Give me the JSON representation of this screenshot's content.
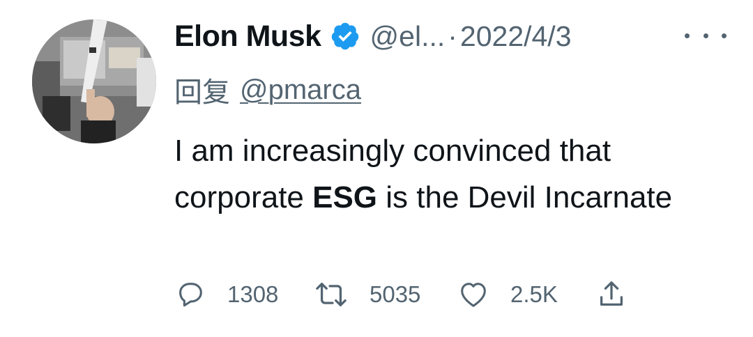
{
  "author": {
    "name": "Elon Musk",
    "handle": "@el...",
    "separator": "·",
    "date": "2022/4/3",
    "verified_icon": "verified-badge-icon"
  },
  "reply": {
    "prefix": "回复",
    "mention": "@pmarca"
  },
  "tweet": {
    "text_before": "I am increasingly convinced that corporate ",
    "text_bold": "ESG",
    "text_after": " is the Devil Incarnate"
  },
  "actions": {
    "reply_count": "1308",
    "retweet_count": "5035",
    "like_count": "2.5K"
  },
  "icons": {
    "more": "more-icon",
    "reply": "reply-icon",
    "retweet": "retweet-icon",
    "like": "heart-icon",
    "share": "share-icon"
  },
  "colors": {
    "text_primary": "#0f1419",
    "text_secondary": "#536471",
    "verified_blue": "#1d9bf0"
  }
}
